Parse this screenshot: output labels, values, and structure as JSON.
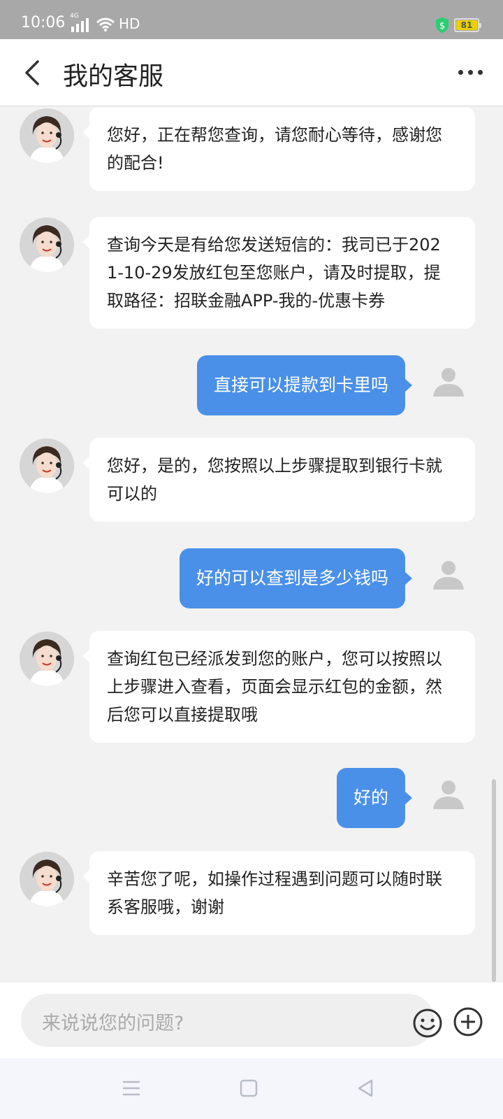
{
  "status_bar": {
    "time": "10:06",
    "network": "4G",
    "hd": "HD",
    "battery": "81",
    "colors": {
      "background": "#a8a8a8",
      "shield": "#2ecc71",
      "battery_fill": "#e9d100"
    }
  },
  "header": {
    "back_icon": "chevron-left-icon",
    "title": "我的客服",
    "more_icon": "more-horizontal-icon"
  },
  "messages": [
    {
      "from": "agent",
      "lines": [
        "您好，正在帮您查询，请您耐心等待，感谢您",
        "的配合!"
      ]
    },
    {
      "from": "agent",
      "lines": [
        "查询今天是有给您发送短信的：我司已于202",
        "1-10-29发放红包至您账户，请及时提取，提",
        "取路径：招联金融APP-我的-优惠卡券"
      ]
    },
    {
      "from": "user",
      "text": "直接可以提款到卡里吗"
    },
    {
      "from": "agent",
      "lines": [
        "您好，是的，您按照以上步骤提取到银行卡就",
        "可以的"
      ]
    },
    {
      "from": "user",
      "text": "好的可以查到是多少钱吗"
    },
    {
      "from": "agent",
      "lines": [
        "查询红包已经派发到您的账户，您可以按照以",
        "上步骤进入查看，页面会显示红包的金额，然",
        "后您可以直接提取哦"
      ]
    },
    {
      "from": "user",
      "text": "好的"
    },
    {
      "from": "agent",
      "lines": [
        "辛苦您了呢，如操作过程遇到问题可以随时联",
        "系客服哦，谢谢"
      ]
    }
  ],
  "input": {
    "placeholder": "来说说您的问题?",
    "emoji_icon": "emoji-icon",
    "plus_icon": "plus-circle-icon"
  },
  "nav": {
    "icons": [
      "menu-icon",
      "home-square-icon",
      "back-triangle-icon"
    ]
  },
  "colors": {
    "user_bubble": "#4a90e8",
    "agent_bubble": "#ffffff",
    "chat_bg": "#f2f2f2"
  }
}
